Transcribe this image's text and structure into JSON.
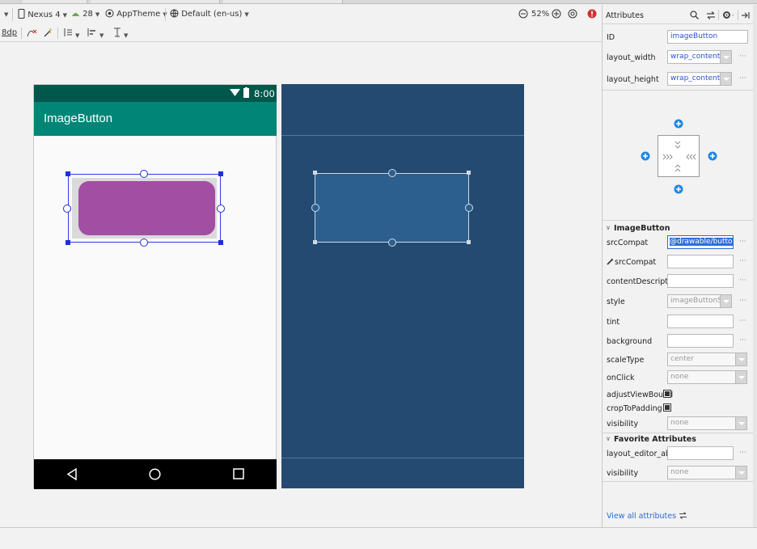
{
  "toolbar": {
    "device": "Nexus 4",
    "api": "28",
    "theme": "AppTheme",
    "locale": "Default (en-us)",
    "zoom": "52%",
    "margin": "8dp",
    "device_icon": "phone-icon",
    "api_icon": "android-icon",
    "theme_icon": "theme-icon",
    "locale_icon": "globe-icon"
  },
  "phone": {
    "time": "8:00",
    "app_title": "ImageButton",
    "statusbar_color": "#00574b",
    "appbar_color": "#008577",
    "button_color": "#a24ea3"
  },
  "attributes": {
    "header": "Attributes",
    "rows_top": [
      {
        "label": "ID",
        "value": "imageButton"
      },
      {
        "label": "layout_width",
        "value": "wrap_content"
      },
      {
        "label": "layout_height",
        "value": "wrap_content"
      }
    ],
    "section_imagebutton": "ImageButton",
    "rows_ib": [
      {
        "label": "srcCompat",
        "value": "@drawable/button1"
      },
      {
        "label": "srcCompat",
        "value": ""
      },
      {
        "label": "contentDescriptio",
        "value": ""
      },
      {
        "label": "style",
        "value": "imageButtonSt"
      },
      {
        "label": "tint",
        "value": ""
      },
      {
        "label": "background",
        "value": ""
      },
      {
        "label": "scaleType",
        "value": "center"
      },
      {
        "label": "onClick",
        "value": "none"
      },
      {
        "label": "adjustViewBound",
        "value": ""
      },
      {
        "label": "cropToPadding",
        "value": ""
      },
      {
        "label": "visibility",
        "value": "none"
      }
    ],
    "section_favorite": "Favorite Attributes",
    "rows_fav": [
      {
        "label": "layout_editor_absc",
        "value": ""
      },
      {
        "label": "visibility",
        "value": "none"
      }
    ],
    "view_all": "View all attributes"
  }
}
